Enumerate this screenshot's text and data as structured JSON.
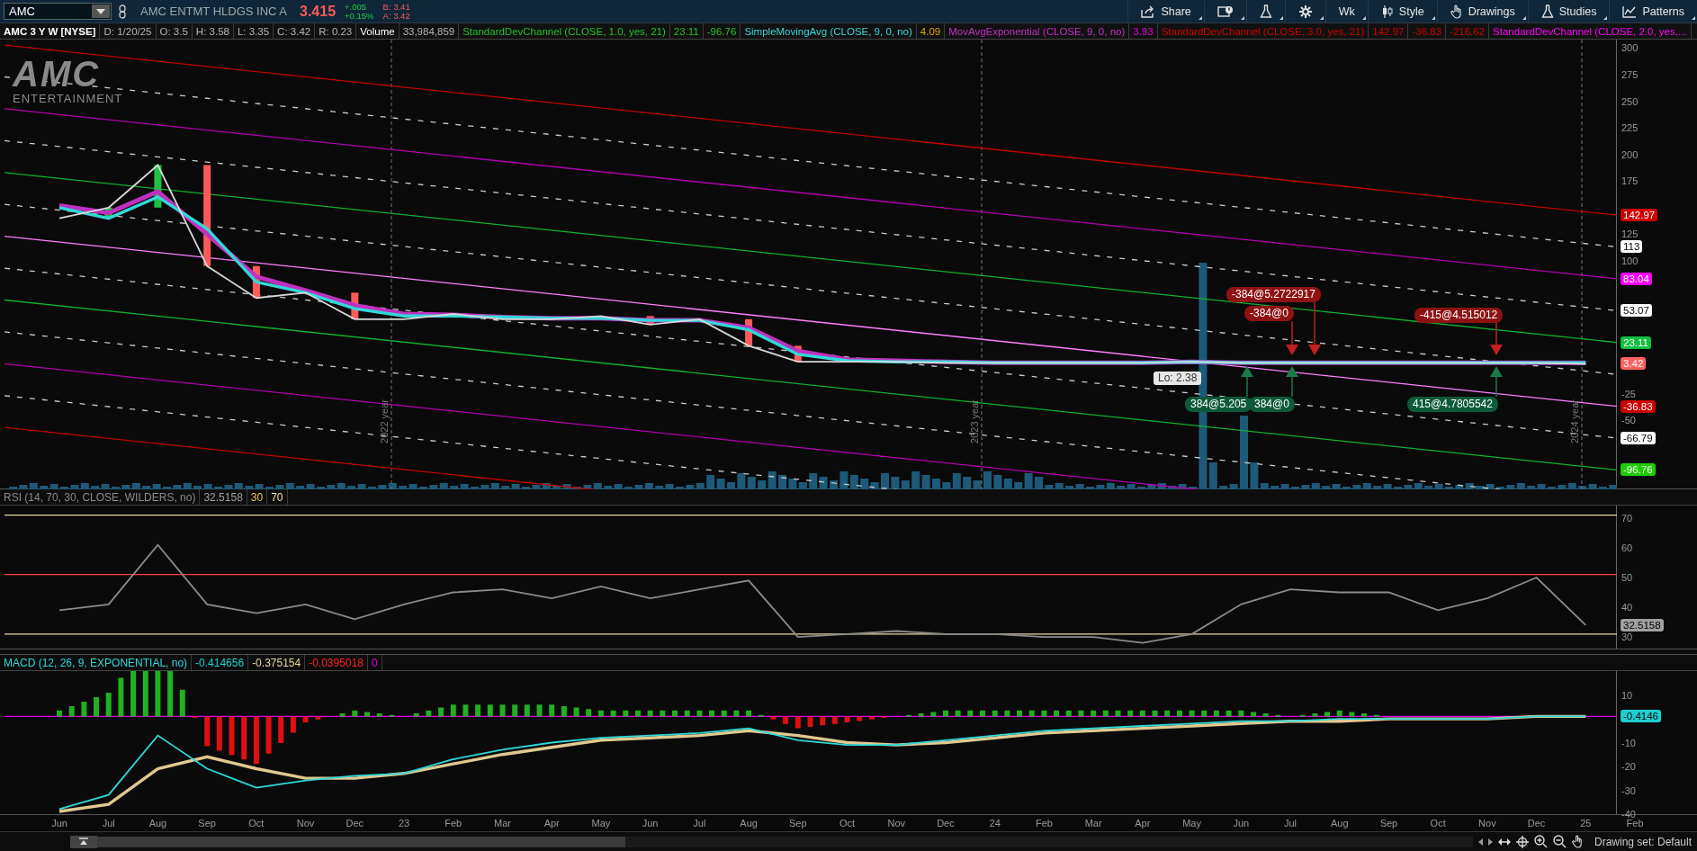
{
  "toolbar": {
    "symbol": "AMC",
    "company": "AMC ENTMT HLDGS INC A",
    "last": "3.415",
    "change": "+.005",
    "change_pct": "+0.15%",
    "bid": "B: 3.41",
    "ask": "A: 3.42",
    "buttons": [
      {
        "kind": "share",
        "label": "Share"
      },
      {
        "kind": "alert"
      },
      {
        "kind": "flask"
      },
      {
        "kind": "gear"
      },
      {
        "kind": "text",
        "label": "Wk"
      },
      {
        "kind": "style",
        "label": "Style"
      },
      {
        "kind": "drawings",
        "label": "Drawings"
      },
      {
        "kind": "studies",
        "label": "Studies"
      },
      {
        "kind": "patterns",
        "label": "Patterns"
      }
    ]
  },
  "price_pane": {
    "legend": [
      {
        "kind": "title"
      },
      {
        "kind": "text",
        "text": "D: 1/20/25",
        "color": "#b4b4b4"
      },
      {
        "kind": "text",
        "text": "O: 3.5",
        "color": "#b4b4b4"
      },
      {
        "kind": "text",
        "text": "H: 3.58",
        "color": "#b4b4b4"
      },
      {
        "kind": "text",
        "text": "L: 3.35",
        "color": "#b4b4b4"
      },
      {
        "kind": "text",
        "text": "C: 3.42",
        "color": "#b4b4b4"
      },
      {
        "kind": "text",
        "text": "R: 0.23",
        "color": "#b4b4b4"
      },
      {
        "kind": "text",
        "text": "Volume",
        "color": "#ffffff"
      },
      {
        "kind": "text",
        "text": "33,984,859",
        "color": "#b4b4b4"
      },
      {
        "kind": "text",
        "text": "StandardDevChannel (CLOSE, 1.0, yes, 21)",
        "color": "#20c030"
      },
      {
        "kind": "text",
        "text": "23.11",
        "color": "#20c030"
      },
      {
        "kind": "text",
        "text": "-96.76",
        "color": "#20c030"
      },
      {
        "kind": "series"
      },
      {
        "kind": "text",
        "text": "4.09",
        "color": "#e0a800"
      },
      {
        "kind": "series"
      },
      {
        "kind": "text",
        "text": "3.93",
        "color": "#e000e0"
      },
      {
        "kind": "text",
        "text": "StandardDevChannel (CLOSE, 3.0, yes, 21)",
        "color": "#d00000"
      },
      {
        "kind": "text",
        "text": "142.97",
        "color": "#d00000"
      },
      {
        "kind": "text",
        "text": "-36.83",
        "color": "#d00000"
      },
      {
        "kind": "text",
        "text": "-216.62",
        "color": "#d00000"
      },
      {
        "kind": "text",
        "text": "StandardDevChannel (CLOSE, 2.0, yes,...",
        "color": "#ff00ff"
      }
    ],
    "logo": {
      "name": "AMC",
      "tagline": "ENTERTAINMENT"
    },
    "year_markers": [
      "2022 year",
      "2023 year",
      "2024 year"
    ],
    "low_label": "Lo: 2.38",
    "orders": [
      {
        "label": "-384@5.2722917",
        "kind": "sell"
      },
      {
        "label": "-384@0",
        "kind": "sell"
      },
      {
        "label": "-415@4.515012",
        "kind": "sell"
      },
      {
        "label": "384@5.205",
        "kind": "buy"
      },
      {
        "label": "384@0",
        "kind": "buy"
      },
      {
        "label": "415@4.7805542",
        "kind": "buy"
      }
    ],
    "axis_badges": [
      {
        "text": "142.97",
        "color": "#cc0000"
      },
      {
        "text": "113",
        "color": "#ffffff"
      },
      {
        "text": "83.04",
        "color": "#ff00ff"
      },
      {
        "text": "53.07",
        "color": "#ffffff"
      },
      {
        "text": "23.11",
        "color": "#10c040"
      },
      {
        "text": "3.42",
        "color": "#ff6060"
      },
      {
        "text": "-36.83",
        "color": "#cc0000"
      },
      {
        "text": "-66.79",
        "color": "#ffffff"
      },
      {
        "text": "-96.76",
        "color": "#20cc00"
      }
    ],
    "chart_data": {
      "type": "line",
      "title": "AMC 3 Y W [NYSE]",
      "ylim": [
        -115,
        308
      ],
      "yticks": [
        300,
        275,
        250,
        225,
        200,
        175,
        125,
        100,
        -25,
        -50
      ],
      "series": [
        {
          "color": "#d8d8d8",
          "values": [
            140,
            150,
            190,
            95,
            65,
            70,
            45,
            45,
            50,
            45,
            45,
            48,
            40,
            45,
            20,
            5,
            5,
            5,
            4,
            4,
            4,
            4,
            4,
            5,
            4,
            4,
            4,
            4,
            4,
            4,
            4,
            3,
            null
          ]
        },
        {
          "name": "SimpleMovingAvg (CLOSE, 9, 0, no)",
          "color": "#30d8d8",
          "values": [
            150,
            140,
            160,
            130,
            80,
            70,
            55,
            48,
            48,
            47,
            46,
            46,
            44,
            44,
            35,
            12,
            6,
            5,
            5,
            4,
            4,
            4,
            4,
            5,
            4,
            4,
            4,
            4,
            4,
            4,
            4,
            4,
            null
          ]
        },
        {
          "name": "MovAvgExponential (CLOSE, 9, 0, no)",
          "color": "#c030c0",
          "values": [
            152,
            145,
            165,
            125,
            85,
            72,
            58,
            50,
            49,
            47,
            46,
            46,
            44,
            44,
            37,
            15,
            7,
            6,
            5,
            4,
            4,
            4,
            4,
            5,
            4,
            4,
            4,
            4,
            4,
            4,
            4,
            4,
            null
          ]
        }
      ]
    }
  },
  "rsi_pane": {
    "legend": [
      {
        "kind": "series"
      },
      {
        "kind": "text",
        "text": "32.5158",
        "color": "#a0a0a0"
      },
      {
        "kind": "text",
        "text": "30",
        "color": "#f0c060"
      },
      {
        "kind": "text",
        "text": "70",
        "color": "#f0e0b0"
      }
    ],
    "badge": {
      "text": "32.5158",
      "color": "#a0a0a0"
    },
    "chart_data": {
      "type": "line",
      "ylim": [
        24.8,
        73.2
      ],
      "yticks": [
        70,
        60,
        50,
        40,
        30
      ],
      "series": [
        {
          "name": "RSI (14, 70, 30, CLOSE, WILDERS, no)",
          "color": "#8a8a8a",
          "values": [
            38,
            40,
            60,
            40,
            37,
            40,
            35,
            40,
            44,
            45,
            42,
            46,
            42,
            45,
            48,
            29,
            30,
            31,
            30,
            30,
            29,
            29,
            27,
            30,
            40,
            45,
            44,
            44,
            38,
            42,
            49,
            33,
            null
          ]
        }
      ]
    }
  },
  "macd_pane": {
    "legend": [
      {
        "kind": "series"
      },
      {
        "kind": "text",
        "text": "-0.414656",
        "color": "#20d0d0"
      },
      {
        "kind": "text",
        "text": "-0.375154",
        "color": "#e8d8a0"
      },
      {
        "kind": "text",
        "text": "-0.0395018",
        "color": "#ff2020"
      },
      {
        "kind": "text",
        "text": "0",
        "color": "#e000e0"
      }
    ],
    "badge": {
      "text": "-0.4146",
      "color": "#20d0d0"
    },
    "chart_data": {
      "type": "line",
      "ylim": [
        -41.5,
        19.1
      ],
      "categories": [
        "Jun",
        "Jul",
        "Aug",
        "Sep",
        "Oct",
        "Nov",
        "Dec",
        "23",
        "Feb",
        "Mar",
        "Apr",
        "May",
        "Jun",
        "Jul",
        "Aug",
        "Sep",
        "Oct",
        "Nov",
        "Dec",
        "24",
        "Feb",
        "Mar",
        "Apr",
        "May",
        "Jun",
        "Jul",
        "Aug",
        "Sep",
        "Oct",
        "Nov",
        "Dec",
        "25",
        "Feb"
      ],
      "yticks": [
        10,
        -10,
        -20,
        -30,
        -40
      ],
      "series": [
        {
          "name": "MACD (12, 26, 9, EXPONENTIAL, no)",
          "color": "#30d8d8",
          "values": [
            -39,
            -33,
            -8,
            -22,
            -30,
            -27,
            -25,
            -24,
            -18,
            -14,
            -11,
            -9,
            -8,
            -7,
            -5,
            -10,
            -12,
            -12,
            -10,
            -8,
            -6,
            -5,
            -4,
            -3,
            -2,
            -2,
            -1,
            -1,
            -1,
            -1,
            0,
            0,
            null
          ]
        },
        {
          "color": "#e0c890",
          "values": [
            -40,
            -37,
            -22,
            -17,
            -22,
            -26,
            -26,
            -24,
            -20,
            -16,
            -13,
            -10,
            -9,
            -8,
            -6,
            -8,
            -11,
            -12,
            -11,
            -9,
            -7,
            -6,
            -5,
            -4,
            -3,
            -2,
            -2,
            -1,
            -1,
            -1,
            0,
            0,
            null
          ]
        }
      ]
    }
  },
  "status_bar": {
    "drawing_set": "Drawing set: Default"
  }
}
